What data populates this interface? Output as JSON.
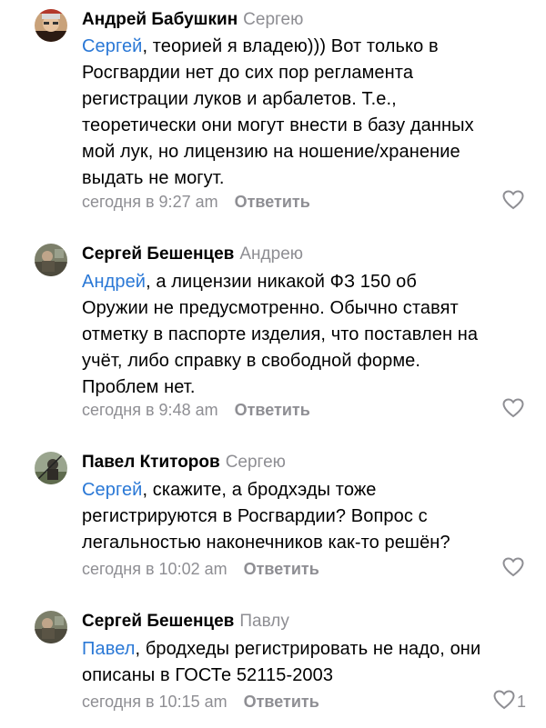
{
  "comments": [
    {
      "author": "Андрей Бабушкин",
      "reply_to": "Сергею",
      "mention": "Сергей",
      "lines": [
        ", теорией я владею))) Вот только в",
        "Росгвардии нет до сих пор регламента",
        "регистрации луков и арбалетов. Т.е.,",
        "теоретически они могут внести в базу данных",
        "мой лук, но лицензию на ношение/хранение",
        "выдать не могут."
      ],
      "time": "сегодня в 9:27 am",
      "reply_label": "Ответить",
      "likes": "",
      "avatar_icon": "user-photo"
    },
    {
      "author": "Сергей Бешенцев",
      "reply_to": "Андрею",
      "mention": "Андрей",
      "lines": [
        ", а лицензии никакой ФЗ 150 об",
        "Оружии  не предусмотренно. Обычно ставят",
        "отметку в паспорте изделия, что поставлен на",
        "учёт,  либо справку в свободной форме.",
        "Проблем нет."
      ],
      "time": "сегодня в 9:48 am",
      "reply_label": "Ответить",
      "likes": "",
      "avatar_icon": "user-photo"
    },
    {
      "author": "Павел Ктиторов",
      "reply_to": "Сергею",
      "mention": "Сергей",
      "lines": [
        ", скажите, а бродхэды тоже",
        "регистрируются в Росгвардии? Вопрос с",
        "легальностью наконечников как-то  решён?"
      ],
      "time": "сегодня в 10:02 am",
      "reply_label": "Ответить",
      "likes": "",
      "avatar_icon": "user-photo"
    },
    {
      "author": "Сергей Бешенцев",
      "reply_to": "Павлу",
      "mention": "Павел",
      "lines": [
        ", бродхеды регистрировать не надо, они",
        "описаны в ГОСТе 52115-2003"
      ],
      "time": "сегодня в 10:15 am",
      "reply_label": "Ответить",
      "likes": "1",
      "avatar_icon": "user-photo"
    }
  ],
  "colors": {
    "mention": "#2a78d6",
    "secondary": "#8e8e93",
    "text": "#000000"
  },
  "icons": {
    "like": "heart-outline-icon"
  }
}
